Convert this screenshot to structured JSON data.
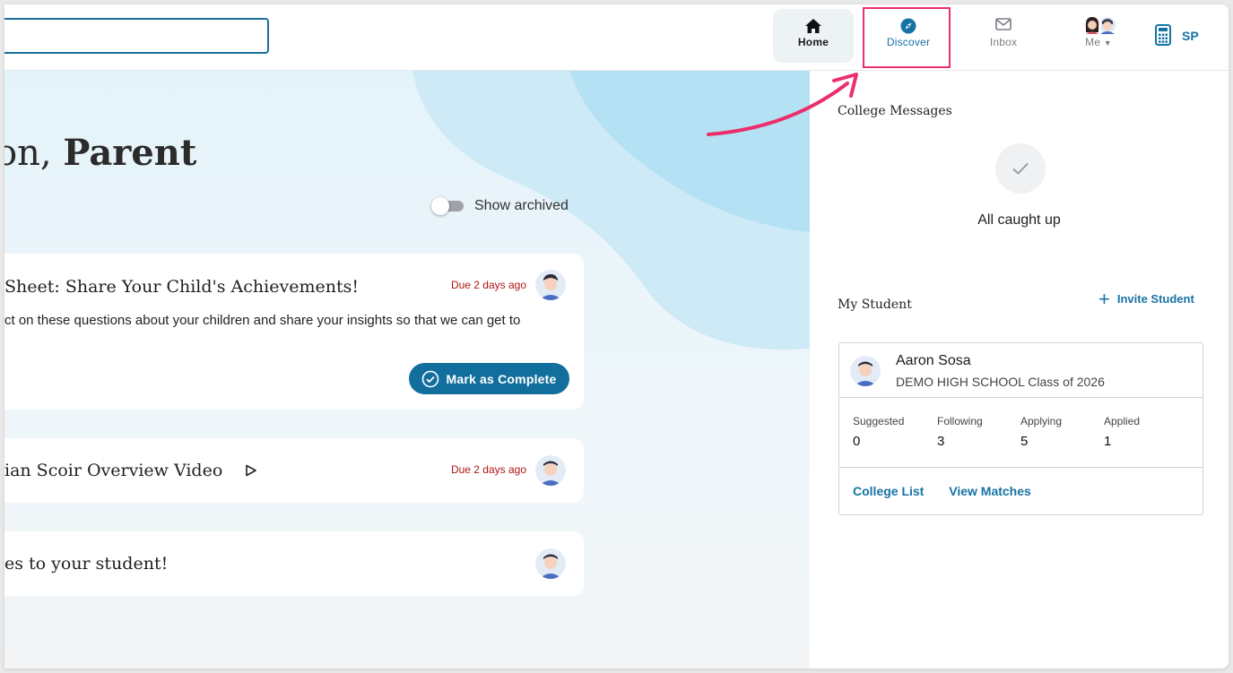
{
  "nav": {
    "home_label": "Home",
    "discover_label": "Discover",
    "inbox_label": "Inbox",
    "me_label": "Me",
    "initials": "SP",
    "accent": "#1773a5",
    "highlight_color": "#ec2f6b"
  },
  "main": {
    "greeting_prefix": "oon, ",
    "greeting_name": "Parent",
    "show_archived_label": "Show archived",
    "cards": [
      {
        "title": "Sheet: Share Your Child's Achievements!",
        "due": "Due 2 days ago",
        "description": "ct on these questions about your children and share your insights so that we can get to",
        "action_label": "Mark as Complete"
      },
      {
        "title": "ian Scoir Overview Video",
        "due": "Due 2 days ago"
      },
      {
        "title": "es to your student!"
      }
    ]
  },
  "side": {
    "college_messages_title": "College Messages",
    "caught_up_text": "All caught up",
    "my_student_title": "My Student",
    "invite_label": "Invite Student",
    "student": {
      "name": "Aaron Sosa",
      "school": "DEMO HIGH SCHOOL Class of 2026",
      "stats": [
        {
          "label": "Suggested",
          "value": "0"
        },
        {
          "label": "Following",
          "value": "3"
        },
        {
          "label": "Applying",
          "value": "5"
        },
        {
          "label": "Applied",
          "value": "1"
        }
      ],
      "college_list_label": "College List",
      "view_matches_label": "View Matches"
    }
  }
}
